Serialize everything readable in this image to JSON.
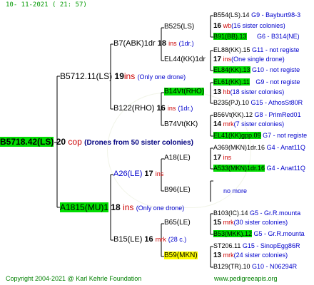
{
  "header": {
    "date": "10- 11-2021 ( 21: 57)"
  },
  "footer": {
    "copyright": "Copyright 2004-2021 @ Karl Kehrle Foundation",
    "url": "www.pedigreeapis.org"
  },
  "colors": {
    "lines": "#c0c0c0",
    "highlight_green": "#00dd00",
    "highlight_yellow": "#ffff00",
    "text_blue": "#0000cc",
    "text_red": "#cc0000"
  },
  "root": {
    "id": "B5718.42(LS)",
    "year": "20",
    "breeder": "cop",
    "note": "(Drones from 50 sister colonies)"
  },
  "gen1": [
    {
      "id": "B5712.11(LS)",
      "year": "19",
      "breeder": "ins",
      "note": "(Only one drone)"
    },
    {
      "id": "A1815(MU)1",
      "year": "18",
      "breeder": "ins",
      "note": "(Only one drone)"
    }
  ],
  "gen2": [
    {
      "id": "B7(ABK)1dr",
      "year": "18",
      "breeder": "ins",
      "note": "(1dr.)"
    },
    {
      "id": "B122(RHO)",
      "year": "16",
      "breeder": "ins",
      "note": "(1dr.)"
    },
    {
      "id": "A26(LE)",
      "year": "17",
      "breeder": "ins",
      "note": ""
    },
    {
      "id": "B15(LE)",
      "year": "16",
      "breeder": "mrk",
      "note": "(28 c.)"
    }
  ],
  "gen3": [
    {
      "id": "B525(LS)",
      "year": "",
      "breeder": "",
      "note": ""
    },
    {
      "id": "EL44(KK)1dr",
      "year": "",
      "breeder": "",
      "note": ""
    },
    {
      "id": "B14Vt(RHO)",
      "year": "",
      "breeder": "",
      "note": ""
    },
    {
      "id": "B74Vt(KK)",
      "year": "",
      "breeder": "",
      "note": ""
    },
    {
      "id": "A18(LE)",
      "year": "",
      "breeder": "",
      "note": ""
    },
    {
      "id": "B96(LE)",
      "year": "",
      "breeder": "",
      "note": ""
    },
    {
      "id": "B65(LE)",
      "year": "",
      "breeder": "",
      "note": ""
    },
    {
      "id": "B59(MKN)",
      "year": "",
      "breeder": "",
      "note": ""
    }
  ],
  "gen3_details": [
    {
      "num": "16",
      "text": "wb",
      "note": "(16 sister colonies)"
    },
    {
      "num": "17",
      "text": "ins",
      "note": "(One single drone)"
    },
    {
      "num": "13",
      "text": "hb",
      "note": "(18 sister colonies)"
    },
    {
      "num": "14",
      "text": "mrk",
      "note": "(7 sister colonies)"
    },
    {
      "num": "17",
      "text": "ins",
      "note": ""
    },
    {
      "num": "",
      "text": "",
      "note": "no more"
    },
    {
      "num": "15",
      "text": "mrk",
      "note": "(30 sister colonies)"
    },
    {
      "num": "13",
      "text": "mrk",
      "note": "(24 sister colonies)"
    }
  ],
  "gen4": [
    {
      "id": "B554(LS).14",
      "rest": "G9 - Bayburt98-3"
    },
    {
      "id": "B91(BB).13",
      "rest": "G6 - B314(NE)"
    },
    {
      "id": "EL88(KK).15",
      "rest": "G11 - not registe"
    },
    {
      "id": "EL84(KK).13",
      "rest": "G10 - not registe"
    },
    {
      "id": "EL61(KK).11",
      "rest": "G9 - not registe"
    },
    {
      "id": "B235(PJ).10",
      "rest": "G15 - AthosSt80R"
    },
    {
      "id": "B56Vt(KK).12",
      "rest": "G8 - PrimRed01"
    },
    {
      "id": "EL41(KK)gpp.09",
      "rest": "G7 - not registe"
    },
    {
      "id": "A369(MKN)1dr.16",
      "rest": "G4 - Anat11Q"
    },
    {
      "id": "A533(MKN)1dr.16",
      "rest": "G4 - Anat11Q"
    },
    {
      "id": "B103(IC).14",
      "rest": "G5 - Gr.R.mounta"
    },
    {
      "id": "B53(MKK).12",
      "rest": "G5 - Gr.R.mounta"
    },
    {
      "id": "ST206.11",
      "rest": "G15 - SinopEgg86R"
    },
    {
      "id": "B129(TR).10",
      "rest": "G10 - N06294R"
    }
  ]
}
